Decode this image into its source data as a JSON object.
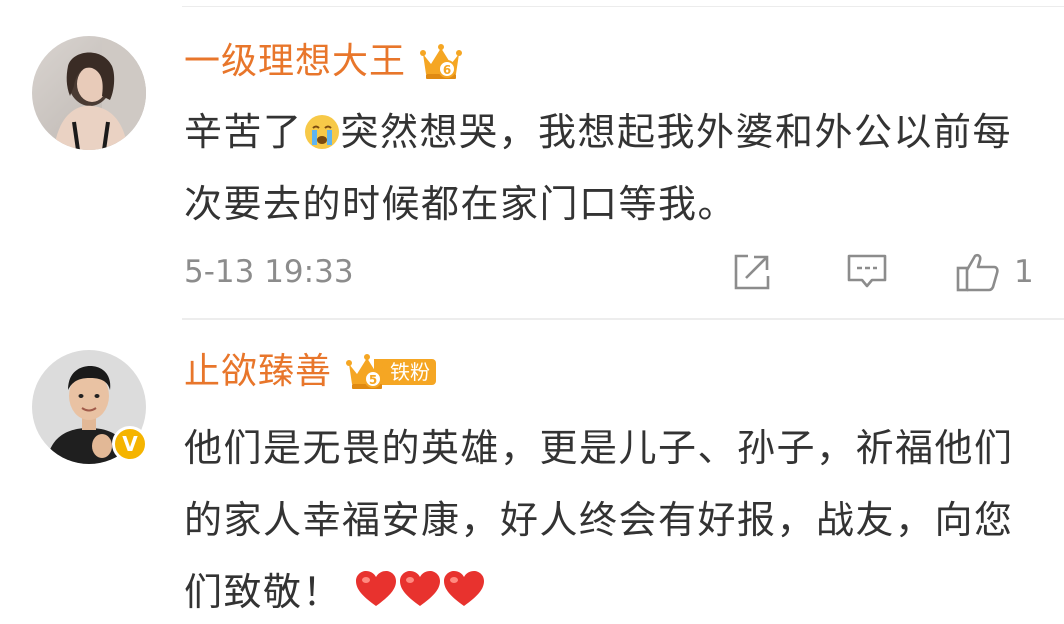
{
  "comments": [
    {
      "username": "一级理想大王",
      "crown_level": "6",
      "text_before_emoji": "辛苦了",
      "emoji": "crying-face-icon",
      "text_after_emoji": "突然想哭，我想起我外婆和外公以前每次要去的时候都在家门口等我。",
      "timestamp": "5-13 19:33",
      "like_count": "1"
    },
    {
      "username": "止欲臻善",
      "crown_level": "5",
      "fan_badge": "铁粉",
      "verified_mark": "V",
      "text": "他们是无畏的英雄，更是儿子、孙子，祈福他们的家人幸福安康，好人终会有好报，战友，向您们致敬！",
      "hearts": [
        "heart-icon",
        "heart-icon",
        "heart-icon"
      ]
    }
  ],
  "colors": {
    "username": "#e8762b",
    "crown": "#f5a623",
    "text": "#333333",
    "meta": "#8c8c8c",
    "heart": "#e8322e",
    "verified": "#f5b400"
  }
}
